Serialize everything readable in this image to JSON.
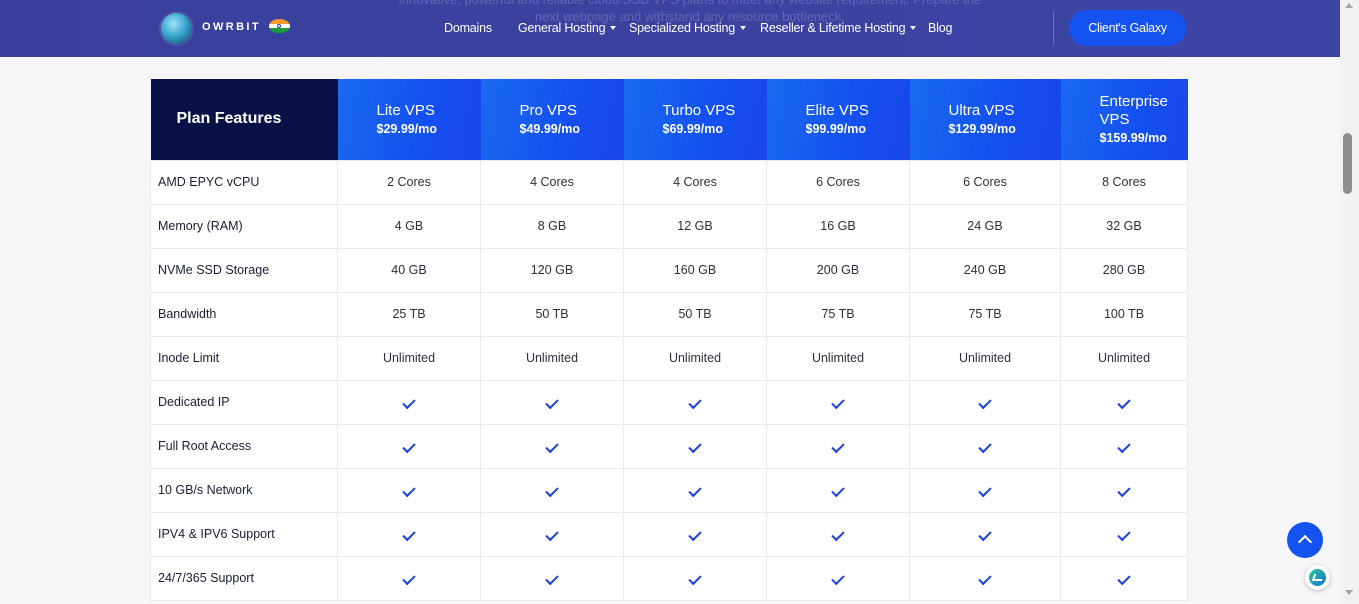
{
  "header": {
    "brand": "OWRBIT",
    "ghost_text_line1": "innovative, powerful and reliable cloud SSD VPS plans to meet any website requirement. Prepare the",
    "ghost_text_line2": "next webpage and withstand any resource bottleneck.",
    "nav": {
      "domains": "Domains",
      "general": "General Hosting",
      "specialized": "Specialized Hosting",
      "reseller": "Reseller & Lifetime Hosting",
      "blog": "Blog"
    },
    "cta": "Client's Galaxy"
  },
  "table": {
    "corner": "Plan Features",
    "plans": [
      {
        "name": "Lite VPS",
        "price": "$29.99/mo"
      },
      {
        "name": "Pro VPS",
        "price": "$49.99/mo"
      },
      {
        "name": "Turbo VPS",
        "price": "$69.99/mo"
      },
      {
        "name": "Elite VPS",
        "price": "$99.99/mo"
      },
      {
        "name": "Ultra VPS",
        "price": "$129.99/mo"
      },
      {
        "name": "Enterprise VPS",
        "price": "$159.99/mo"
      }
    ],
    "rows": [
      {
        "feature": "AMD EPYC vCPU",
        "values": [
          "2 Cores",
          "4 Cores",
          "4 Cores",
          "6 Cores",
          "6 Cores",
          "8 Cores"
        ]
      },
      {
        "feature": "Memory (RAM)",
        "values": [
          "4 GB",
          "8 GB",
          "12 GB",
          "16 GB",
          "24 GB",
          "32 GB"
        ]
      },
      {
        "feature": "NVMe SSD Storage",
        "values": [
          "40 GB",
          "120 GB",
          "160 GB",
          "200 GB",
          "240 GB",
          "280 GB"
        ]
      },
      {
        "feature": "Bandwidth",
        "values": [
          "25 TB",
          "50 TB",
          "50 TB",
          "75 TB",
          "75 TB",
          "100 TB"
        ]
      },
      {
        "feature": "Inode Limit",
        "values": [
          "Unlimited",
          "Unlimited",
          "Unlimited",
          "Unlimited",
          "Unlimited",
          "Unlimited"
        ]
      },
      {
        "feature": "Dedicated IP",
        "check": true
      },
      {
        "feature": "Full Root Access",
        "check": true
      },
      {
        "feature": "10 GB/s Network",
        "check": true
      },
      {
        "feature": "IPV4 & IPV6 Support",
        "check": true
      },
      {
        "feature": "24/7/365 Support",
        "check": true
      }
    ]
  },
  "icons": {
    "logo": "globe-logo-icon",
    "flag": "india-flag-icon",
    "check": "checkmark-icon",
    "back_to_top": "arrow-up-icon",
    "chat": "chat-widget-icon"
  },
  "colors": {
    "header_bg": "#3b429f",
    "accent": "#1453f0",
    "feature_header_bg": "#0a1147",
    "check": "#1c3fe0"
  }
}
